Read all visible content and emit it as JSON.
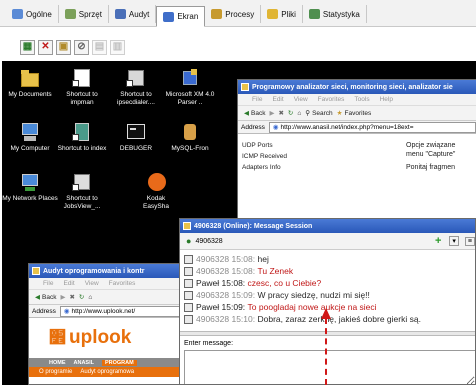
{
  "tabs": [
    {
      "label": "Ogólne",
      "color": "#5b8bd6"
    },
    {
      "label": "Sprzęt",
      "color": "#7ba05a"
    },
    {
      "label": "Audyt",
      "color": "#4a6fb8"
    },
    {
      "label": "Ekran",
      "color": "#3f6ec9"
    },
    {
      "label": "Procesy",
      "color": "#c79a2e"
    },
    {
      "label": "Pliki",
      "color": "#e0b534"
    },
    {
      "label": "Statystyka",
      "color": "#4f8f4f"
    }
  ],
  "active_tab": "Ekran",
  "toolbar": {
    "b1": "▦",
    "b2": "✕",
    "b3": "▣",
    "b4": "⊘",
    "b5": "▤",
    "b6": "▥"
  },
  "desktop_icons": [
    {
      "label": "My Documents"
    },
    {
      "label": "Shortcut to impman"
    },
    {
      "label": "Shortcut to ipsecdialer...."
    },
    {
      "label": "Microsoft XM 4.0 Parser .."
    },
    {
      "label": "My Computer"
    },
    {
      "label": "Shortcut to index"
    },
    {
      "label": "DEBUGER"
    },
    {
      "label": "MySQL-Fron"
    },
    {
      "label": "My Network Places"
    },
    {
      "label": "Shortcut to JobsView_..."
    },
    {
      "label": "Kodak EasySha"
    }
  ],
  "anasil_window": {
    "title": "Programowy analizator sieci, monitoring sieci, analizator sie",
    "menu": [
      "File",
      "Edit",
      "View",
      "Favorites",
      "Tools",
      "Help"
    ],
    "nav": {
      "back": "Back",
      "search": "Search",
      "favorites": "Favorites"
    },
    "address_label": "Address",
    "address": "http://www.anasil.net/index.php?menu=18ext=",
    "left_items": [
      "UDP Ports",
      "ICMP Received",
      "Adapters Info"
    ],
    "right_text": [
      "Opcje związane",
      "menu \"Capture\"",
      "Ponitaj fragmen"
    ]
  },
  "uplook_window": {
    "title": "Audyt oprogramowania i kontr",
    "menu": [
      "File",
      "Edit",
      "View",
      "Favorites"
    ],
    "nav": {
      "back": "Back"
    },
    "address_label": "Address",
    "address": "http://www.uplook.net/",
    "logo": "uplook",
    "nav_links": [
      "HOME",
      "ANASIL",
      "PROGRAM"
    ],
    "sub_links": [
      "O programie",
      "Audyt oprogramowa"
    ]
  },
  "chat": {
    "title": "4906328 (Online): Message Session",
    "contact": "4906328",
    "messages": [
      {
        "who": "4906328",
        "time": "15:08:",
        "text": "hej",
        "color": "#8a8a8a",
        "tcolor": "#2a2a2a"
      },
      {
        "who": "4906328",
        "time": "15:08:",
        "text": "Tu Zenek",
        "color": "#8a8a8a",
        "tcolor": "#c01818"
      },
      {
        "who": "Paweł",
        "time": "15:08:",
        "text": "czesc, co u Ciebie?",
        "color": "#222222",
        "tcolor": "#c01818"
      },
      {
        "who": "4906328",
        "time": "15:09:",
        "text": "W pracy siedzę, nudzi mi się!!",
        "color": "#8a8a8a",
        "tcolor": "#2a2a2a"
      },
      {
        "who": "Paweł",
        "time": "15:09:",
        "text": "To poogladaj nowe aukcje na sieci",
        "color": "#222222",
        "tcolor": "#c01818"
      },
      {
        "who": "4906328",
        "time": "15:10:",
        "text": "Dobra, zaraz zerknę, jakieś dobre gierki są.",
        "color": "#8a8a8a",
        "tcolor": "#2a2a2a"
      }
    ],
    "enter_label": "Enter message:",
    "input_value": ""
  },
  "colors": {
    "desktop": "#000000",
    "title_bar": "#2a58b8",
    "highlight": "#c01818"
  }
}
